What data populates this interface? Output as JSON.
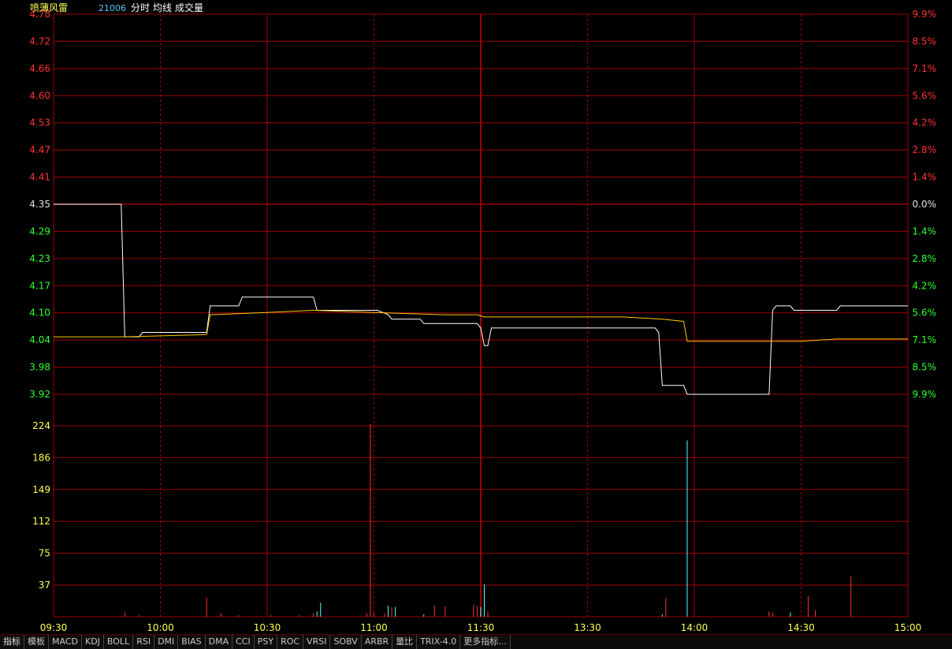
{
  "header": {
    "name": "喷薄风雷",
    "code": "21006",
    "mode": "分时",
    "avg_label": "均线",
    "vol_label": "成交量"
  },
  "colors": {
    "grid": "#a00000",
    "up": "#ff3232",
    "down": "#32ff32",
    "neutral": "#e0e0e0",
    "price_line": "#ffffff",
    "avg_line": "#ffc800",
    "vol_up": "#ff3232",
    "vol_down": "#54ffff",
    "vol_label": "#ffff54",
    "time_label": "#ffff54",
    "header_name": "#ffff54",
    "header_code": "#54c8ff"
  },
  "chart_data": {
    "type": "line",
    "prev_close": 4.35,
    "price_ticks": [
      "4.78",
      "4.72",
      "4.66",
      "4.60",
      "4.53",
      "4.47",
      "4.41",
      "4.35",
      "4.29",
      "4.23",
      "4.17",
      "4.10",
      "4.04",
      "3.98",
      "3.92"
    ],
    "pct_ticks": [
      "9.9%",
      "8.5%",
      "7.1%",
      "5.6%",
      "4.2%",
      "2.8%",
      "1.4%",
      "0.0%",
      "1.4%",
      "2.8%",
      "4.2%",
      "5.6%",
      "7.1%",
      "8.5%",
      "9.9%"
    ],
    "volume_ticks": [
      "224",
      "186",
      "149",
      "112",
      "75",
      "37"
    ],
    "time_ticks": [
      "09:30",
      "10:00",
      "10:30",
      "11:00",
      "11:30",
      "13:30",
      "14:00",
      "14:30",
      "15:00"
    ],
    "ylim": [
      3.92,
      4.78
    ],
    "volume_ylim": [
      0,
      262
    ],
    "minutes": 240,
    "series": [
      {
        "key": "price",
        "points": [
          [
            0,
            4.35
          ],
          [
            19,
            4.35
          ],
          [
            20,
            4.05
          ],
          [
            24,
            4.05
          ],
          [
            25,
            4.06
          ],
          [
            43,
            4.06
          ],
          [
            44,
            4.12
          ],
          [
            52,
            4.12
          ],
          [
            53,
            4.14
          ],
          [
            73,
            4.14
          ],
          [
            74,
            4.11
          ],
          [
            88,
            4.11
          ],
          [
            91,
            4.11
          ],
          [
            94,
            4.1
          ],
          [
            95,
            4.09
          ],
          [
            103,
            4.09
          ],
          [
            104,
            4.08
          ],
          [
            119,
            4.08
          ],
          [
            120,
            4.07
          ],
          [
            121,
            4.03
          ],
          [
            122,
            4.03
          ],
          [
            123,
            4.07
          ],
          [
            169,
            4.07
          ],
          [
            170,
            4.06
          ],
          [
            171,
            3.94
          ],
          [
            177,
            3.94
          ],
          [
            178,
            3.92
          ],
          [
            201,
            3.92
          ],
          [
            202,
            4.11
          ],
          [
            203,
            4.12
          ],
          [
            207,
            4.12
          ],
          [
            208,
            4.11
          ],
          [
            220,
            4.11
          ],
          [
            221,
            4.12
          ],
          [
            240,
            4.12
          ]
        ]
      },
      {
        "key": "average",
        "points": [
          [
            0,
            4.05
          ],
          [
            20,
            4.05
          ],
          [
            43,
            4.055
          ],
          [
            44,
            4.1
          ],
          [
            60,
            4.105
          ],
          [
            73,
            4.11
          ],
          [
            90,
            4.105
          ],
          [
            110,
            4.1
          ],
          [
            119,
            4.1
          ],
          [
            121,
            4.095
          ],
          [
            160,
            4.095
          ],
          [
            171,
            4.09
          ],
          [
            177,
            4.085
          ],
          [
            178,
            4.04
          ],
          [
            201,
            4.04
          ],
          [
            210,
            4.04
          ],
          [
            220,
            4.045
          ],
          [
            240,
            4.045
          ]
        ]
      }
    ],
    "volumes": [
      {
        "t": 20,
        "v": 6,
        "up": true
      },
      {
        "t": 24,
        "v": 2,
        "up": true
      },
      {
        "t": 43,
        "v": 26,
        "up": true
      },
      {
        "t": 47,
        "v": 5,
        "up": true
      },
      {
        "t": 52,
        "v": 2,
        "up": true
      },
      {
        "t": 61,
        "v": 2,
        "up": true
      },
      {
        "t": 69,
        "v": 2,
        "up": true
      },
      {
        "t": 73,
        "v": 5,
        "up": true
      },
      {
        "t": 74,
        "v": 7,
        "up": false
      },
      {
        "t": 75,
        "v": 19,
        "up": false
      },
      {
        "t": 88,
        "v": 5,
        "up": true
      },
      {
        "t": 89,
        "v": 262,
        "up": true
      },
      {
        "t": 90,
        "v": 5,
        "up": true
      },
      {
        "t": 93,
        "v": 4,
        "up": true
      },
      {
        "t": 94,
        "v": 15,
        "up": false
      },
      {
        "t": 95,
        "v": 13,
        "up": true
      },
      {
        "t": 96,
        "v": 13,
        "up": false
      },
      {
        "t": 104,
        "v": 3,
        "up": false
      },
      {
        "t": 107,
        "v": 15,
        "up": true
      },
      {
        "t": 110,
        "v": 14,
        "up": true
      },
      {
        "t": 118,
        "v": 16,
        "up": true
      },
      {
        "t": 119,
        "v": 14,
        "up": true
      },
      {
        "t": 120,
        "v": 13,
        "up": false
      },
      {
        "t": 121,
        "v": 44,
        "up": false
      },
      {
        "t": 122,
        "v": 7,
        "up": true
      },
      {
        "t": 171,
        "v": 3,
        "up": false
      },
      {
        "t": 172,
        "v": 25,
        "up": true
      },
      {
        "t": 178,
        "v": 240,
        "up": false
      },
      {
        "t": 201,
        "v": 7,
        "up": true
      },
      {
        "t": 202,
        "v": 6,
        "up": true
      },
      {
        "t": 207,
        "v": 6,
        "up": false
      },
      {
        "t": 212,
        "v": 28,
        "up": true
      },
      {
        "t": 214,
        "v": 9,
        "up": true
      },
      {
        "t": 224,
        "v": 55,
        "up": true
      }
    ]
  },
  "tabs": [
    "指标",
    "模板",
    "MACD",
    "KDJ",
    "BOLL",
    "RSI",
    "DMI",
    "BIAS",
    "DMA",
    "CCI",
    "PSY",
    "ROC",
    "VRSI",
    "SOBV",
    "ARBR",
    "量比",
    "TRIX-4.0",
    "更多指标..."
  ]
}
